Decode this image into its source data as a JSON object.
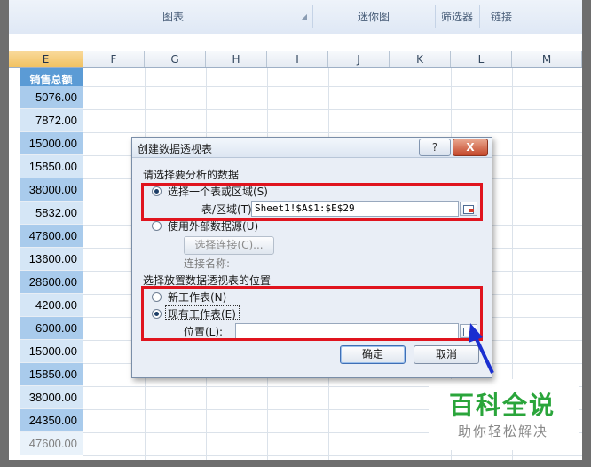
{
  "ribbon": {
    "groups": [
      "图表",
      "迷你图",
      "筛选器",
      "链接"
    ]
  },
  "columns": [
    "E",
    "F",
    "G",
    "H",
    "I",
    "J",
    "K",
    "L",
    "M"
  ],
  "sheet": {
    "header": "销售总额",
    "values": [
      "5076.00",
      "7872.00",
      "15000.00",
      "15850.00",
      "38000.00",
      "5832.00",
      "47600.00",
      "13600.00",
      "28600.00",
      "4200.00",
      "6000.00",
      "15000.00",
      "15850.00",
      "38000.00",
      "24350.00",
      "47600.00"
    ]
  },
  "dialog": {
    "title": "创建数据透视表",
    "help_label": "?",
    "close_label": "X",
    "section_data": "请选择要分析的数据",
    "opt_table_range": "选择一个表或区域(S)",
    "table_range_label": "表/区域(T):",
    "table_range_value": "Sheet1!$A$1:$E$29",
    "opt_external": "使用外部数据源(U)",
    "choose_connection": "选择连接(C)...",
    "connection_name": "连接名称:",
    "section_location": "选择放置数据透视表的位置",
    "opt_new_sheet": "新工作表(N)",
    "opt_existing_sheet": "现有工作表(E)",
    "location_label": "位置(L):",
    "location_value": "",
    "ok": "确定",
    "cancel": "取消"
  },
  "watermark": {
    "brand": "百科全说",
    "tagline": "助你轻松解决"
  },
  "colors": {
    "highlight_box": "#e0141e",
    "arrow": "#1a2fd0",
    "header_fill": "#5b9bd5",
    "cell_fill": "#a9cbec"
  },
  "icons": [
    "range-picker-icon",
    "radio-icon",
    "annotation-arrow-icon"
  ]
}
